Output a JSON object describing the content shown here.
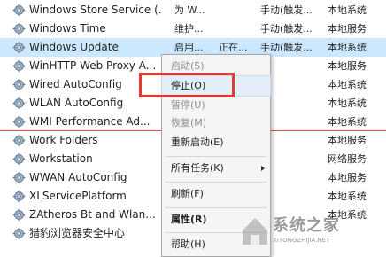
{
  "services": [
    {
      "name": "Windows Store Service (...",
      "desc": "为 W...",
      "status": "",
      "start": "手动(触发...",
      "logon": "本地系统"
    },
    {
      "name": "Windows Time",
      "desc": "维护...",
      "status": "",
      "start": "手动(触发...",
      "logon": "本地服务"
    },
    {
      "name": "Windows Update",
      "desc": "启用...",
      "status": "正在...",
      "start": "手动(触发...",
      "logon": "本地系统",
      "selected": true
    },
    {
      "name": "WinHTTP Web Proxy A...",
      "desc": "",
      "status": "",
      "start": "",
      "logon": "本地服务"
    },
    {
      "name": "Wired AutoConfig",
      "desc": "",
      "status": "",
      "start": "",
      "logon": "本地系统"
    },
    {
      "name": "WLAN AutoConfig",
      "desc": "",
      "status": "",
      "start": "",
      "logon": "本地系统"
    },
    {
      "name": "WMI Performance Ad...",
      "desc": "",
      "status": "",
      "start": "",
      "logon": "本地系统"
    },
    {
      "name": "Work Folders",
      "desc": "",
      "status": "",
      "start": "",
      "logon": "本地服务"
    },
    {
      "name": "Workstation",
      "desc": "",
      "status": "",
      "start": "",
      "logon": "网络服务"
    },
    {
      "name": "WWAN AutoConfig",
      "desc": "",
      "status": "",
      "start": "",
      "logon": "本地服务"
    },
    {
      "name": "XLServicePlatform",
      "desc": "",
      "status": "",
      "start": "",
      "logon": "本地系统"
    },
    {
      "name": "ZAtheros Bt and Wlan...",
      "desc": "",
      "status": "",
      "start": "",
      "logon": "本地系统"
    },
    {
      "name": "猎豹浏览器安全中心",
      "desc": "",
      "status": "",
      "start": "",
      "logon": ""
    }
  ],
  "context_menu": {
    "start": "启动(S)",
    "stop": "停止(O)",
    "pause": "暂停(U)",
    "resume": "恢复(M)",
    "restart": "重新启动(E)",
    "all_tasks": "所有任务(K)",
    "refresh": "刷新(F)",
    "properties": "属性(R)",
    "help": "帮助(H)"
  },
  "watermark": {
    "text": "系统之家",
    "url": "XITONGZHIJIA.NET"
  },
  "colors": {
    "selection": "#cce8ff",
    "highlight": "#e03a33"
  }
}
